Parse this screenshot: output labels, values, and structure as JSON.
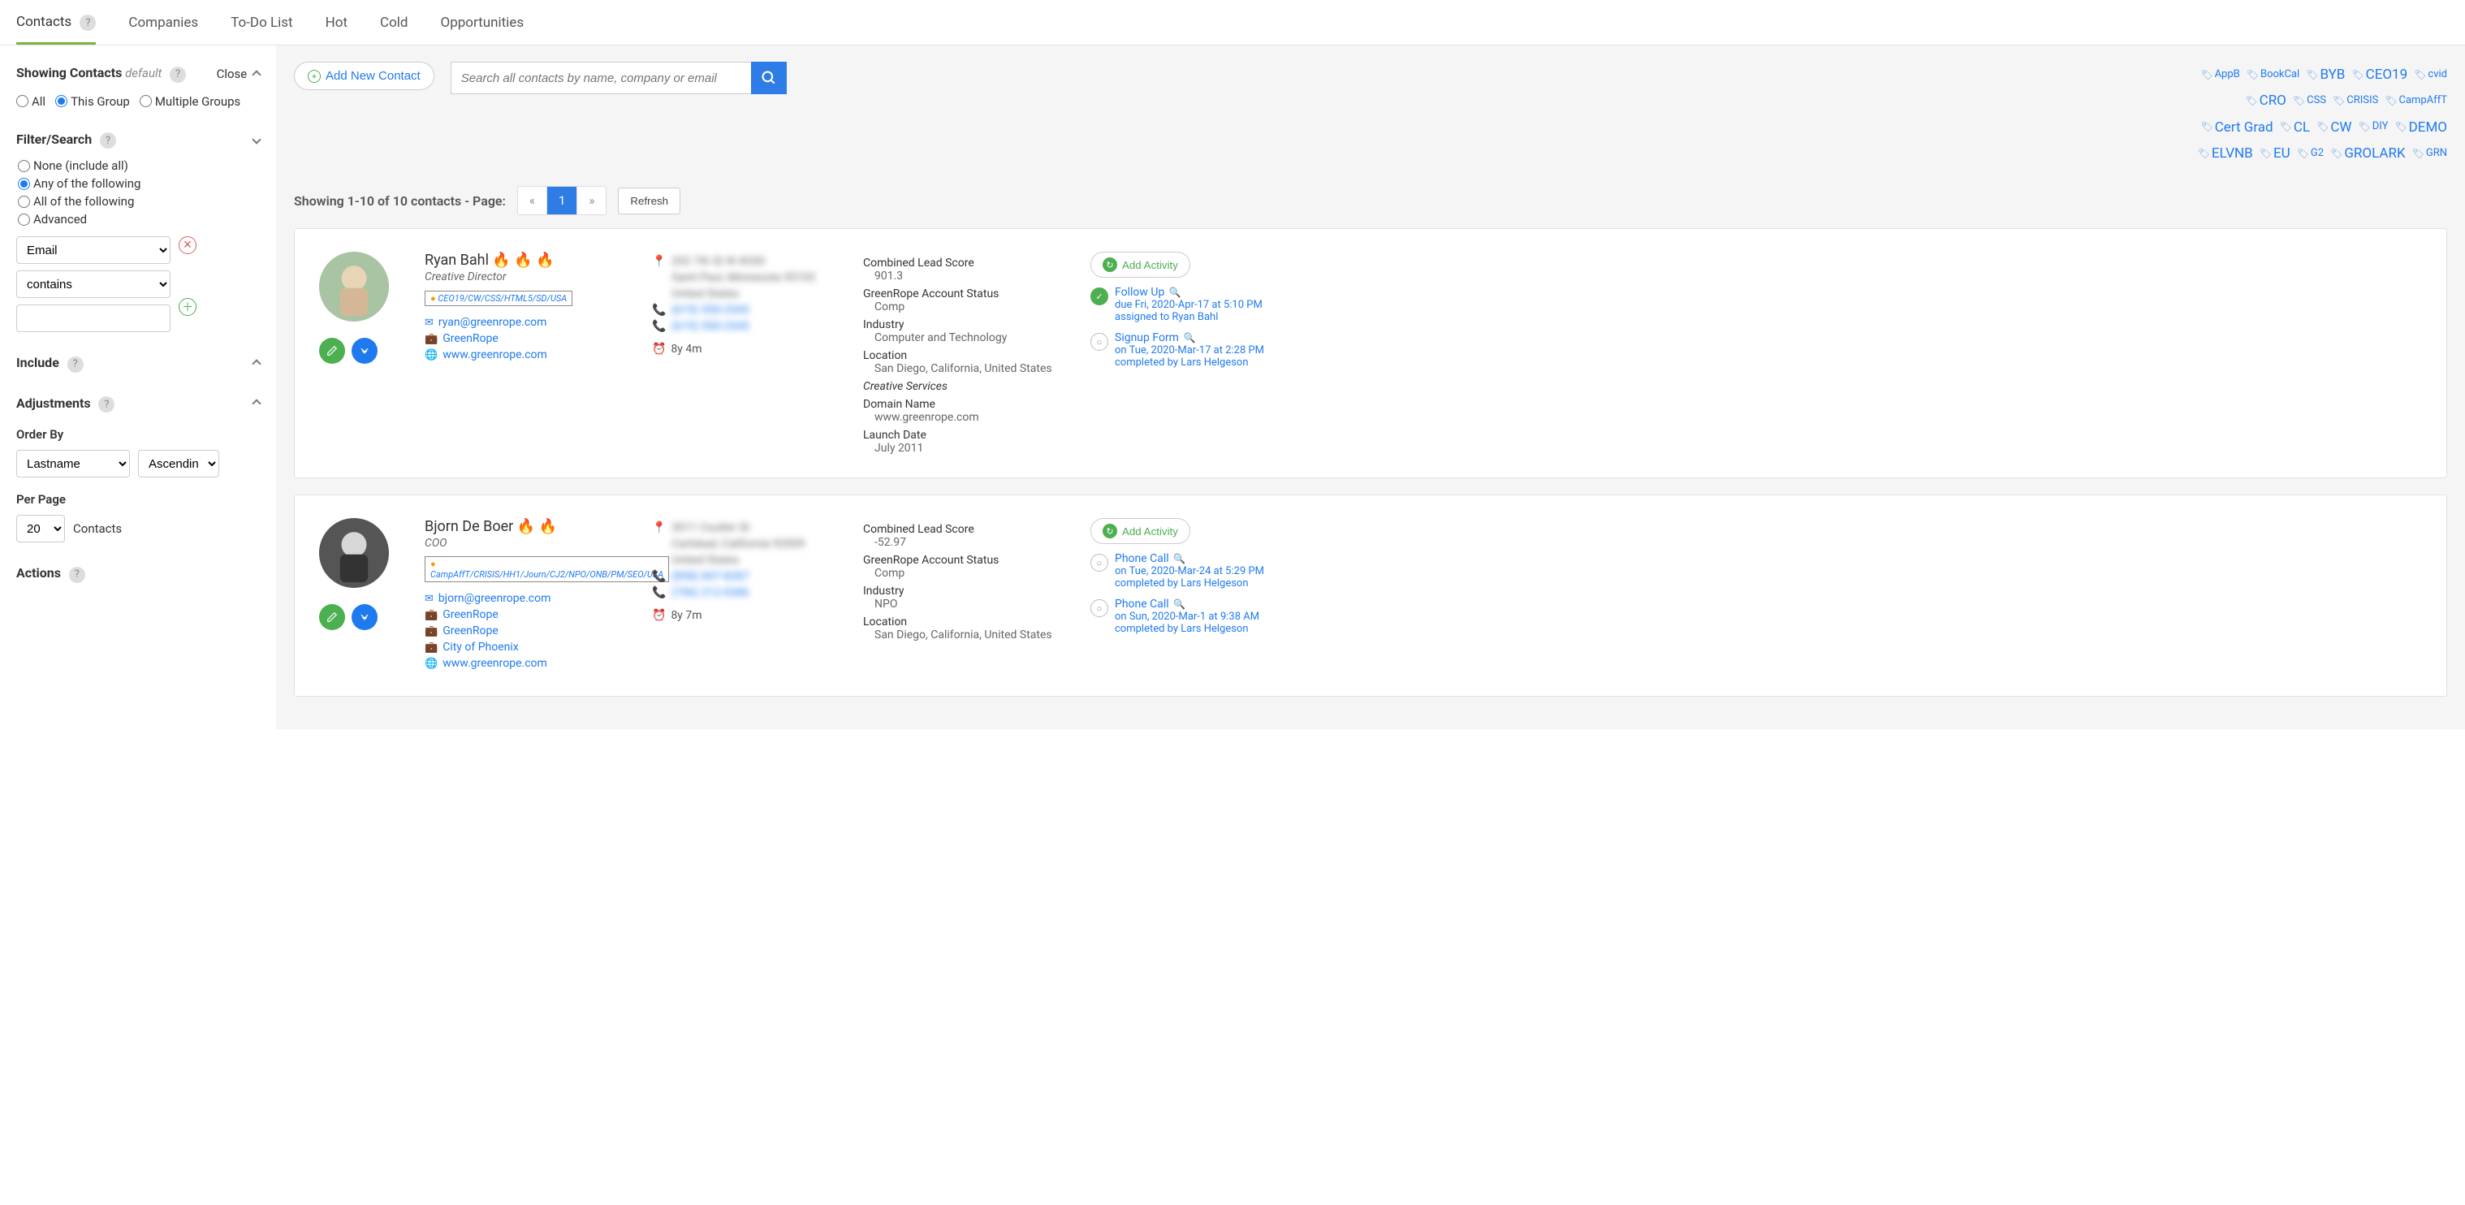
{
  "nav": {
    "contacts": "Contacts",
    "companies": "Companies",
    "todo": "To-Do List",
    "hot": "Hot",
    "cold": "Cold",
    "opportunities": "Opportunities"
  },
  "sidebar": {
    "showing_label": "Showing Contacts",
    "default": "default",
    "close": "Close",
    "scope": {
      "all": "All",
      "this_group": "This Group",
      "multiple": "Multiple Groups"
    },
    "filter_hdr": "Filter/Search",
    "filter_opts": {
      "none": "None (include all)",
      "any": "Any of the following",
      "all": "All of the following",
      "advanced": "Advanced"
    },
    "filter_field": "Email",
    "filter_op": "contains",
    "include_hdr": "Include",
    "adjustments_hdr": "Adjustments",
    "orderby_lbl": "Order By",
    "orderby_val": "Lastname",
    "orderby_dir": "Ascending",
    "perpage_lbl": "Per Page",
    "perpage_val": "20",
    "perpage_suffix": "Contacts",
    "actions_hdr": "Actions"
  },
  "toolbar": {
    "add_contact": "Add New Contact",
    "search_placeholder": "Search all contacts by name, company or email",
    "refresh": "Refresh",
    "showing_text": "Showing 1-10 of 10 contacts - Page:",
    "page": "1",
    "prev": "«",
    "next": "»"
  },
  "tags": [
    {
      "t": "AppB",
      "s": "sm"
    },
    {
      "t": "BookCal",
      "s": "sm"
    },
    {
      "t": "BYB",
      "s": "big"
    },
    {
      "t": "CEO19",
      "s": "big"
    },
    {
      "t": "cvid",
      "s": "sm"
    },
    {
      "t": "CRO",
      "s": "big"
    },
    {
      "t": "CSS",
      "s": "sm"
    },
    {
      "t": "CRISIS",
      "s": "sm"
    },
    {
      "t": "CampAffT",
      "s": "sm"
    },
    {
      "t": "Cert Grad",
      "s": "big"
    },
    {
      "t": "CL",
      "s": "big"
    },
    {
      "t": "CW",
      "s": "big"
    },
    {
      "t": "DIY",
      "s": "sm"
    },
    {
      "t": "DEMO",
      "s": "big"
    },
    {
      "t": "ELVNB",
      "s": "big"
    },
    {
      "t": "EU",
      "s": "big"
    },
    {
      "t": "G2",
      "s": "sm"
    },
    {
      "t": "GROLARK",
      "s": "big"
    },
    {
      "t": "GRN",
      "s": "sm"
    }
  ],
  "contacts": [
    {
      "name": "Ryan Bahl 🔥 🔥 🔥",
      "title": "Creative Director",
      "tags": "CEO19/CW/CSS/HTML5/SD/USA",
      "email": "ryan@greenrope.com",
      "company1": "GreenRope",
      "website": "www.greenrope.com",
      "addr1": "202 7th St W #200",
      "addr2": "Saint Paul, Minnesota 55102",
      "addr3": "United States",
      "phone1": "(619) 550-2545",
      "phone2": "(619) 550-2545",
      "tenure": "8y 4m",
      "attrs": {
        "score_lbl": "Combined Lead Score",
        "score_val": "901.3",
        "status_lbl": "GreenRope Account Status",
        "status_val": "Comp",
        "industry_lbl": "Industry",
        "industry_val": "Computer and Technology",
        "location_lbl": "Location",
        "location_val": "San Diego, California, United States",
        "cs_lbl": "Creative Services",
        "domain_lbl": "Domain Name",
        "domain_val": "www.greenrope.com",
        "launch_lbl": "Launch Date",
        "launch_val": "July 2011"
      },
      "activities": [
        {
          "title": "Follow Up",
          "l1": "due Fri, 2020-Apr-17 at 5:10 PM",
          "l2": "assigned to Ryan Bahl",
          "solid": true
        },
        {
          "title": "Signup Form",
          "l1": "on Tue, 2020-Mar-17 at 2:28 PM",
          "l2": "completed by Lars Helgeson",
          "solid": false
        }
      ]
    },
    {
      "name": "Bjorn De Boer 🔥 🔥",
      "title": "COO",
      "tags": "CampAffT/CRISIS/HH1/Journ/CJ2/NPO/ONB/PM/SEO/USA",
      "email": "bjorn@greenrope.com",
      "company1": "GreenRope",
      "company2": "GreenRope",
      "company3": "City of Phoenix",
      "website": "www.greenrope.com",
      "addr1": "3011 Coulter St",
      "addr2": "Carlsbad, California 92009",
      "addr3": "United States",
      "phone1": "(858) 847-8287",
      "phone2": "(706) 212-0386",
      "tenure": "8y 7m",
      "attrs": {
        "score_lbl": "Combined Lead Score",
        "score_val": "-52.97",
        "status_lbl": "GreenRope Account Status",
        "status_val": "Comp",
        "industry_lbl": "Industry",
        "industry_val": "NPO",
        "location_lbl": "Location",
        "location_val": "San Diego, California, United States"
      },
      "activities": [
        {
          "title": "Phone Call",
          "l1": "on Tue, 2020-Mar-24 at 5:29 PM",
          "l2": "completed by Lars Helgeson",
          "solid": false
        },
        {
          "title": "Phone Call",
          "l1": "on Sun, 2020-Mar-1 at 9:38 AM",
          "l2": "completed by Lars Helgeson",
          "solid": false
        }
      ]
    }
  ],
  "add_activity_lbl": "Add Activity"
}
